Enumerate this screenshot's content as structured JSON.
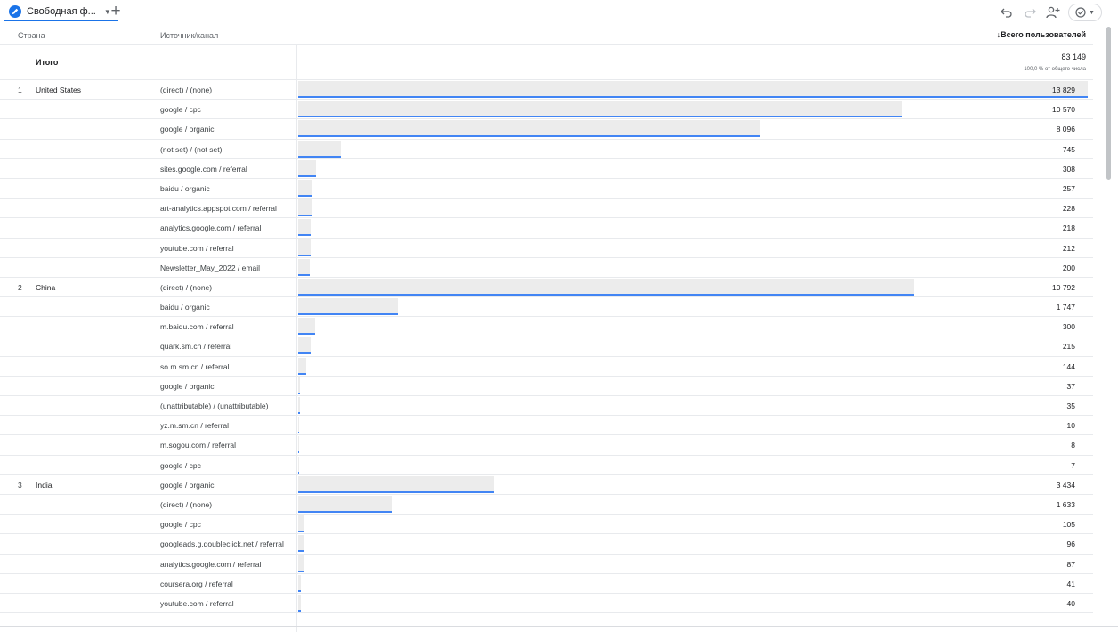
{
  "tab": {
    "label": "Свободная ф...",
    "icon": "pencil-icon"
  },
  "toolbar": {
    "icons": [
      "undo-icon",
      "redo-icon",
      "share-user-icon",
      "compare-icon"
    ]
  },
  "table": {
    "headers": {
      "dim1": "Страна",
      "dim2": "Источник/канал",
      "metric": "↓Всего пользователей"
    },
    "total": {
      "label": "Итого",
      "value": "83 149",
      "percent": "100,0 % от общего числа"
    },
    "max": 13829,
    "rows": [
      {
        "idx": "1",
        "country": "United States",
        "source": "(direct) / (none)",
        "value": "13 829",
        "v": 13829
      },
      {
        "idx": "",
        "country": "",
        "source": "google / cpc",
        "value": "10 570",
        "v": 10570
      },
      {
        "idx": "",
        "country": "",
        "source": "google / organic",
        "value": "8 096",
        "v": 8096
      },
      {
        "idx": "",
        "country": "",
        "source": "(not set) / (not set)",
        "value": "745",
        "v": 745
      },
      {
        "idx": "",
        "country": "",
        "source": "sites.google.com / referral",
        "value": "308",
        "v": 308
      },
      {
        "idx": "",
        "country": "",
        "source": "baidu / organic",
        "value": "257",
        "v": 257
      },
      {
        "idx": "",
        "country": "",
        "source": "art-analytics.appspot.com / referral",
        "value": "228",
        "v": 228
      },
      {
        "idx": "",
        "country": "",
        "source": "analytics.google.com / referral",
        "value": "218",
        "v": 218
      },
      {
        "idx": "",
        "country": "",
        "source": "youtube.com / referral",
        "value": "212",
        "v": 212
      },
      {
        "idx": "",
        "country": "",
        "source": "Newsletter_May_2022 / email",
        "value": "200",
        "v": 200
      },
      {
        "idx": "2",
        "country": "China",
        "source": "(direct) / (none)",
        "value": "10 792",
        "v": 10792
      },
      {
        "idx": "",
        "country": "",
        "source": "baidu / organic",
        "value": "1 747",
        "v": 1747
      },
      {
        "idx": "",
        "country": "",
        "source": "m.baidu.com / referral",
        "value": "300",
        "v": 300
      },
      {
        "idx": "",
        "country": "",
        "source": "quark.sm.cn / referral",
        "value": "215",
        "v": 215
      },
      {
        "idx": "",
        "country": "",
        "source": "so.m.sm.cn / referral",
        "value": "144",
        "v": 144
      },
      {
        "idx": "",
        "country": "",
        "source": "google / organic",
        "value": "37",
        "v": 37
      },
      {
        "idx": "",
        "country": "",
        "source": "(unattributable) / (unattributable)",
        "value": "35",
        "v": 35
      },
      {
        "idx": "",
        "country": "",
        "source": "yz.m.sm.cn / referral",
        "value": "10",
        "v": 10
      },
      {
        "idx": "",
        "country": "",
        "source": "m.sogou.com / referral",
        "value": "8",
        "v": 8
      },
      {
        "idx": "",
        "country": "",
        "source": "google / cpc",
        "value": "7",
        "v": 7
      },
      {
        "idx": "3",
        "country": "India",
        "source": "google / organic",
        "value": "3 434",
        "v": 3434
      },
      {
        "idx": "",
        "country": "",
        "source": "(direct) / (none)",
        "value": "1 633",
        "v": 1633
      },
      {
        "idx": "",
        "country": "",
        "source": "google / cpc",
        "value": "105",
        "v": 105
      },
      {
        "idx": "",
        "country": "",
        "source": "googleads.g.doubleclick.net / referral",
        "value": "96",
        "v": 96
      },
      {
        "idx": "",
        "country": "",
        "source": "analytics.google.com / referral",
        "value": "87",
        "v": 87
      },
      {
        "idx": "",
        "country": "",
        "source": "coursera.org / referral",
        "value": "41",
        "v": 41
      },
      {
        "idx": "",
        "country": "",
        "source": "youtube.com / referral",
        "value": "40",
        "v": 40
      }
    ]
  }
}
